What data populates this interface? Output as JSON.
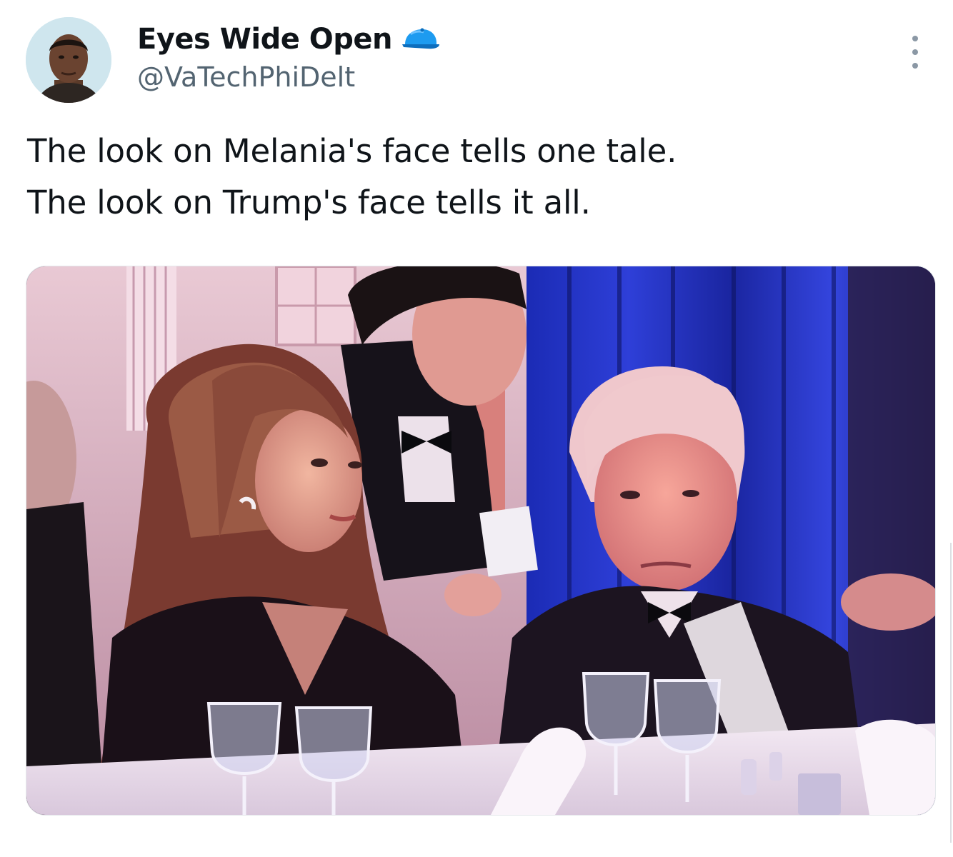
{
  "author": {
    "display_name": "Eyes Wide Open",
    "handle": "@VaTechPhiDelt",
    "badge_icon": "blue-cap-icon",
    "badge_color": "#1d9bf0"
  },
  "tweet": {
    "lines": [
      "The look on Melania's face tells one tale.",
      "The look on Trump's face tells it all."
    ]
  },
  "media": {
    "type": "photo"
  },
  "icons": {
    "more": "more-vertical-icon"
  },
  "colors": {
    "text_primary": "#0f1419",
    "text_secondary": "#536471",
    "accent": "#1d9bf0"
  }
}
